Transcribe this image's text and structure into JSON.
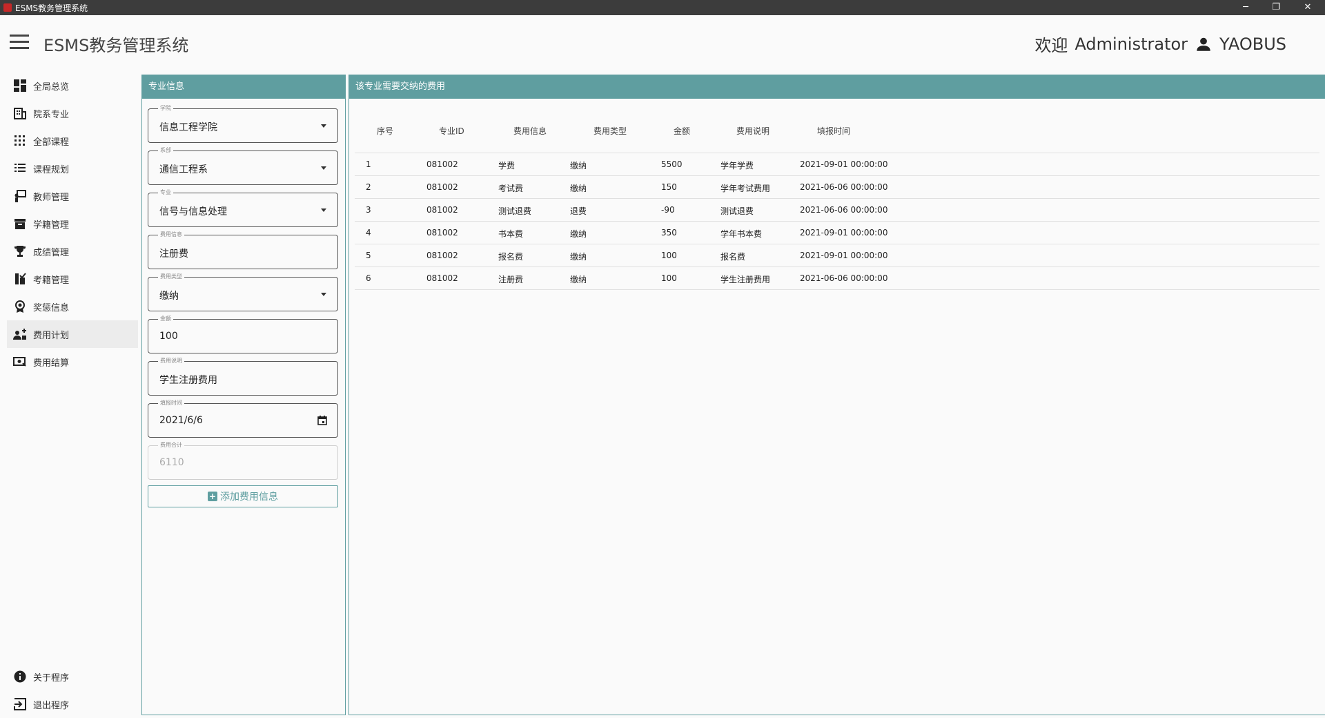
{
  "window": {
    "title": "ESMS教务管理系统",
    "controls": {
      "minimize": "─",
      "maximize": "❐",
      "close": "✕"
    }
  },
  "header": {
    "title": "ESMS教务管理系统",
    "welcome": "欢迎",
    "user": "Administrator",
    "account": "YAOBUS"
  },
  "sidebar": {
    "items": [
      {
        "label": "全局总览",
        "icon": "dashboard-icon"
      },
      {
        "label": "院系专业",
        "icon": "building-icon"
      },
      {
        "label": "全部课程",
        "icon": "grid-dots-icon"
      },
      {
        "label": "课程规划",
        "icon": "list-icon"
      },
      {
        "label": "教师管理",
        "icon": "teacher-icon"
      },
      {
        "label": "学籍管理",
        "icon": "archive-icon"
      },
      {
        "label": "成绩管理",
        "icon": "trophy-icon"
      },
      {
        "label": "考籍管理",
        "icon": "exam-icon"
      },
      {
        "label": "奖惩信息",
        "icon": "award-icon"
      },
      {
        "label": "费用计划",
        "icon": "cost-plan-icon",
        "active": true
      },
      {
        "label": "费用结算",
        "icon": "cash-icon"
      }
    ],
    "bottom": [
      {
        "label": "关于程序",
        "icon": "info-icon"
      },
      {
        "label": "退出程序",
        "icon": "exit-icon"
      }
    ]
  },
  "form": {
    "header": "专业信息",
    "fields": [
      {
        "label": "学院",
        "value": "信息工程学院",
        "type": "select"
      },
      {
        "label": "系部",
        "value": "通信工程系",
        "type": "select"
      },
      {
        "label": "专业",
        "value": "信号与信息处理",
        "type": "select"
      },
      {
        "label": "费用信息",
        "value": "注册费",
        "type": "text"
      },
      {
        "label": "费用类型",
        "value": "缴纳",
        "type": "select"
      },
      {
        "label": "金额",
        "value": "100",
        "type": "text"
      },
      {
        "label": "费用说明",
        "value": "学生注册费用",
        "type": "text"
      },
      {
        "label": "填报时间",
        "value": "2021/6/6",
        "type": "date"
      },
      {
        "label": "费用合计",
        "value": "6110",
        "type": "disabled"
      }
    ],
    "add_button": "添加费用信息"
  },
  "table": {
    "header": "该专业需要交纳的费用",
    "columns": [
      "序号",
      "专业ID",
      "费用信息",
      "费用类型",
      "金额",
      "费用说明",
      "填报时间"
    ],
    "rows": [
      [
        "1",
        "081002",
        "学费",
        "缴纳",
        "5500",
        "学年学费",
        "2021-09-01 00:00:00"
      ],
      [
        "2",
        "081002",
        "考试费",
        "缴纳",
        "150",
        "学年考试费用",
        "2021-06-06 00:00:00"
      ],
      [
        "3",
        "081002",
        "测试退费",
        "退费",
        "-90",
        "测试退费",
        "2021-06-06 00:00:00"
      ],
      [
        "4",
        "081002",
        "书本费",
        "缴纳",
        "350",
        "学年书本费",
        "2021-09-01 00:00:00"
      ],
      [
        "5",
        "081002",
        "报名费",
        "缴纳",
        "100",
        "报名费",
        "2021-09-01 00:00:00"
      ],
      [
        "6",
        "081002",
        "注册费",
        "缴纳",
        "100",
        "学生注册费用",
        "2021-06-06 00:00:00"
      ]
    ]
  }
}
